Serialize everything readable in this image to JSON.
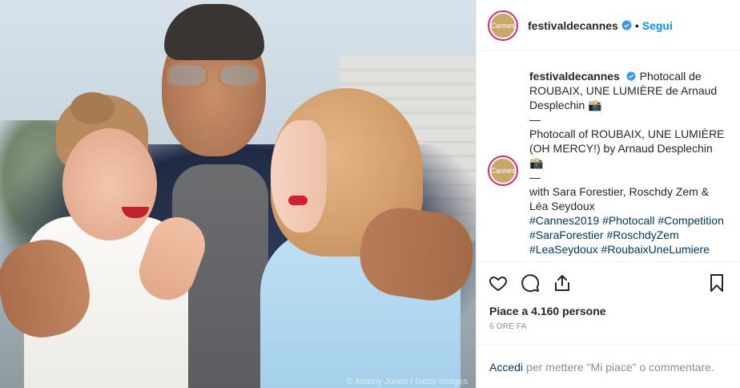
{
  "post": {
    "account": {
      "username": "festivaldecannes",
      "follow_label": "Segui",
      "separator": "•",
      "more_label": "···",
      "avatar_text": "Cannes",
      "verified_icon": "verified-badge-icon",
      "brand_color": "#0095f6"
    },
    "photo": {
      "credit": "© Antony Jones / Getty Images"
    },
    "caption": {
      "username": "festivaldecannes",
      "text": "Photocall de ROUBAIX, UNE LUMIÈRE de Arnaud Desplechin 📸\n—\nPhotocall of ROUBAIX, UNE LUMIÈRE (OH MERCY!) by Arnaud Desplechin 📸\n—\nwith Sara Forestier, Roschdy Zem & Léa Seydoux",
      "hashtags": [
        "#Cannes2019",
        "#Photocall",
        "#Competition",
        "#SaraForestier",
        "#RoschdyZem",
        "#LeaSeydoux",
        "#RoubaixUneLumiere"
      ]
    },
    "actions": {
      "like_icon": "heart-icon",
      "comment_icon": "comment-icon",
      "share_icon": "share-icon",
      "save_icon": "bookmark-icon"
    },
    "likes_text": "Piace a 4.160 persone",
    "timestamp": "6 ORE FA",
    "comment_prompt": {
      "login_label": "Accedi",
      "rest": "per mettere \"Mi piace\" o commentare."
    }
  }
}
